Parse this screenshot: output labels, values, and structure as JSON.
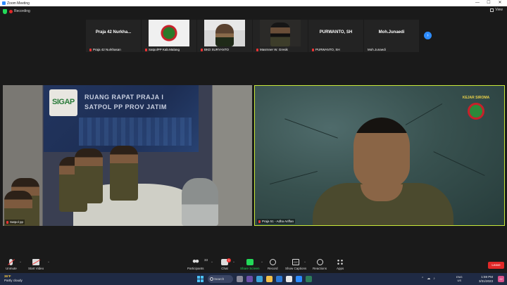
{
  "window": {
    "title": "Zoom Meeting",
    "minimize": "—",
    "maximize": "☐",
    "close": "✕"
  },
  "status": {
    "recording_label": "Recording",
    "view_label": "View"
  },
  "thumbnails": [
    {
      "display_name": "Praja 42 Nurkhasan",
      "big_text": "Praja 42 Nurkha...",
      "picture": "none"
    },
    {
      "display_name": "SatpolPP Kab.Malang",
      "big_text": "",
      "picture": "badge"
    },
    {
      "display_name": "BKD SURYANTO",
      "big_text": "",
      "picture": "office"
    },
    {
      "display_name": "Masrnner W. Gresik",
      "big_text": "",
      "picture": "dark"
    },
    {
      "display_name": "PURWANTO, SH",
      "big_text": "PURWANTO, SH",
      "picture": "none"
    },
    {
      "display_name": "Moh.Junaedi",
      "big_text": "Moh.Junaedi",
      "picture": "none"
    }
  ],
  "left_tile": {
    "name": "Satpol pp",
    "banner_logo_text": "SIGAP",
    "banner_line1": "RUANG RAPAT PRAJA I",
    "banner_line2": "SATPOL PP PROV JATIM"
  },
  "right_tile": {
    "name": "Praja 51 - Adha Ariffan",
    "emblem_text": "KEJAR SIROMA",
    "active_speaker_color": "#c8e83a"
  },
  "controls": {
    "unmute": "Unmute",
    "start_video": "Start Video",
    "participants": "Participants",
    "participants_count": "33",
    "chat": "Chat",
    "chat_badge": "1",
    "share_screen": "Share Screen",
    "record": "Record",
    "show_captions": "Show Captions",
    "reactions": "Reactions",
    "apps": "Apps",
    "leave": "Leave"
  },
  "taskbar": {
    "weather_temp": "36°F",
    "weather_desc": "Partly cloudy",
    "search": "Search",
    "lang_top": "ENG",
    "lang_bottom": "US",
    "time": "1:59 PM",
    "date": "3/31/2023",
    "notif_count": "22"
  },
  "colors": {
    "zoom_blue": "#2d8cff",
    "share_green": "#23d959",
    "leave_red": "#e02828",
    "taskbar_bg": "#1f2a44"
  }
}
